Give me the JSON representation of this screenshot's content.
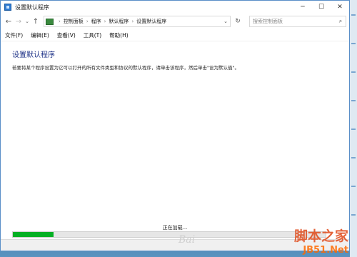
{
  "window": {
    "title": "设置默认程序",
    "minimize_glyph": "─",
    "maximize_glyph": "☐",
    "close_glyph": "✕"
  },
  "nav": {
    "back_glyph": "←",
    "forward_glyph": "→",
    "caret_glyph": "⌄",
    "up_glyph": "↑"
  },
  "address": {
    "breadcrumbs": [
      "控制面板",
      "程序",
      "默认程序",
      "设置默认程序"
    ],
    "separator": "›",
    "dropdown_glyph": "⌄",
    "refresh_glyph": "↻"
  },
  "search": {
    "placeholder": "搜索控制面板",
    "icon": "search-icon",
    "glyph": "⌕"
  },
  "menu": [
    "文件(F)",
    "编辑(E)",
    "查看(V)",
    "工具(T)",
    "帮助(H)"
  ],
  "main": {
    "title": "设置默认程序",
    "description": "若要将某个程序设置为它可以打开的所有文件类型和协议的默认程序，请单击该程序，然后单击\"设为默认值\"。",
    "loading_text": "正在加载...",
    "progress_percent": 13
  },
  "watermark": {
    "line1": "脚本之家",
    "line2": "JB51.Net",
    "baidu": "Bai"
  },
  "colors": {
    "title_blue": "#1e3287",
    "progress_green": "#06b025"
  }
}
